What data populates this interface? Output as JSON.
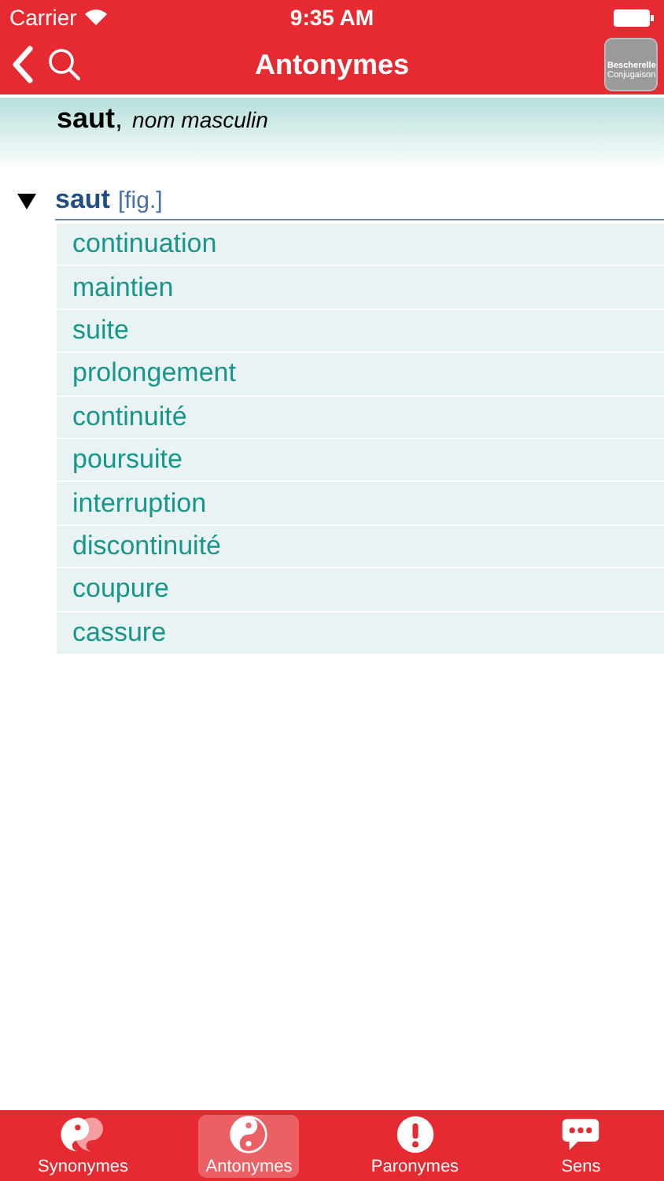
{
  "status_bar": {
    "carrier": "Carrier",
    "time": "9:35 AM"
  },
  "nav": {
    "title": "Antonymes",
    "logo": {
      "line_1": "Bescherelle",
      "line_2": "Conjugaison"
    }
  },
  "entry": {
    "word": "saut",
    "separator": ",",
    "category": "nom masculin"
  },
  "groups": [
    {
      "expanded": true,
      "word": "saut",
      "note": "[fig.]",
      "items": [
        "continuation",
        "maintien",
        "suite",
        "prolongement",
        "continuité",
        "poursuite",
        "interruption",
        "discontinuité",
        "coupure",
        "cassure"
      ]
    }
  ],
  "tabs": [
    {
      "kind": "synonyms",
      "label": "Synonymes",
      "selected": false
    },
    {
      "kind": "antonyms",
      "label": "Antonymes",
      "selected": true
    },
    {
      "kind": "paronyms",
      "label": "Paronymes",
      "selected": false
    },
    {
      "kind": "meaning",
      "label": "Sens",
      "selected": false
    }
  ]
}
